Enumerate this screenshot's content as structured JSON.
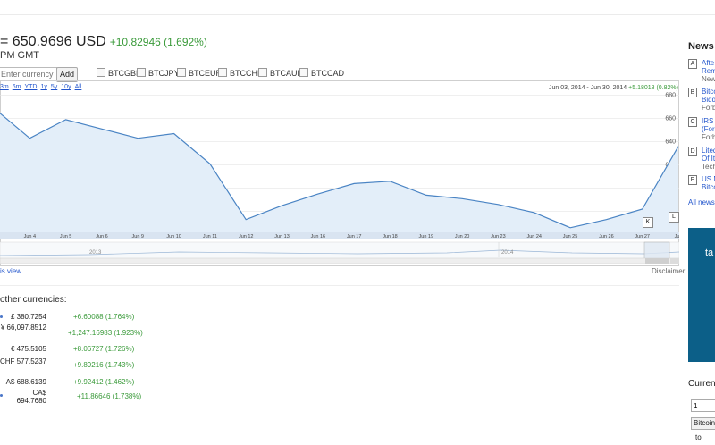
{
  "header": {
    "rate_text": "= 650.9696 USD",
    "change_text": "+10.82946 (1.692%)",
    "time_text": "PM GMT"
  },
  "controls": {
    "currency_placeholder": "Enter currency",
    "add_label": "Add",
    "compare": [
      "BTCGBP",
      "BTCJPY",
      "BTCEUR",
      "BTCCHF",
      "BTCAUD",
      "BTCCAD"
    ]
  },
  "chart": {
    "zoom_links": [
      "3m",
      "6m",
      "YTD",
      "1y",
      "5y",
      "10y",
      "All"
    ],
    "range_text": "Jun 03, 2014 - Jun 30, 2014",
    "range_change": "+5.18018 (0.82%)",
    "k_label": "K",
    "l_label": "L",
    "years": [
      "2013",
      "2014"
    ],
    "below_link": "is view",
    "disclaimer": "Disclaimer"
  },
  "chart_data": {
    "type": "area",
    "x": [
      "Jun 3",
      "Jun 4",
      "Jun 5",
      "Jun 6",
      "Jun 9",
      "Jun 10",
      "Jun 11",
      "Jun 12",
      "Jun 13",
      "Jun 16",
      "Jun 17",
      "Jun 18",
      "Jun 19",
      "Jun 20",
      "Jun 23",
      "Jun 24",
      "Jun 25",
      "Jun 26",
      "Jun 27",
      "Jun 30"
    ],
    "x_tick_labels": [
      "3",
      "Jun 4",
      "Jun 5",
      "Jun 6",
      "Jun 9",
      "Jun 10",
      "Jun 11",
      "Jun 12",
      "Jun 13",
      "Jun 16",
      "Jun 17",
      "Jun 18",
      "Jun 19",
      "Jun 20",
      "Jun 23",
      "Jun 24",
      "Jun 25",
      "Jun 26",
      "Jun 27",
      "Jun"
    ],
    "values": [
      669,
      643,
      659,
      651,
      643,
      647,
      621,
      573,
      585,
      595,
      604,
      606,
      594,
      591,
      586,
      579,
      566,
      573,
      582,
      636
    ],
    "ylim": [
      562,
      682
    ],
    "yticks": [
      580,
      600,
      620,
      640,
      660,
      680
    ],
    "grid": true,
    "line_color": "#4a84c4",
    "fill_color": "#e3eef9"
  },
  "other": {
    "heading": "other currencies:",
    "rows": [
      {
        "value": "£ 380.7254",
        "change": "+6.60088 (1.764%)"
      },
      {
        "value": "¥ 66,097.8512",
        "change": "+1,247.16983 (1.923%)"
      },
      {
        "value": "€ 475.5105",
        "change": "+8.06727 (1.726%)"
      },
      {
        "value": "CHF 577.5237",
        "change": "+9.89216 (1.743%)"
      },
      {
        "value": "A$ 688.6139",
        "change": "+9.92412 (1.462%)"
      },
      {
        "value": "CA$ 694.7680",
        "change": "+11.86646 (1.738%)"
      }
    ]
  },
  "news": {
    "heading": "News",
    "items": [
      {
        "letter": "A",
        "l1": "Afte",
        "l2": "Rem",
        "l3": "New"
      },
      {
        "letter": "B",
        "l1": "Bitco",
        "l2": "Bidd",
        "l3": "Forb"
      },
      {
        "letter": "C",
        "l1": "IRS",
        "l2": "(For",
        "l3": "Forb"
      },
      {
        "letter": "D",
        "l1": "Lited",
        "l2": "Of It",
        "l3": "Tech"
      },
      {
        "letter": "E",
        "l1": "US M",
        "l2": "Bitco",
        "l3": ""
      }
    ],
    "all_news": "All news"
  },
  "ad": {
    "text": "ta"
  },
  "converter": {
    "heading": "Currenc",
    "amount": "1",
    "currency": "Bitcoin",
    "to_label": "to"
  }
}
